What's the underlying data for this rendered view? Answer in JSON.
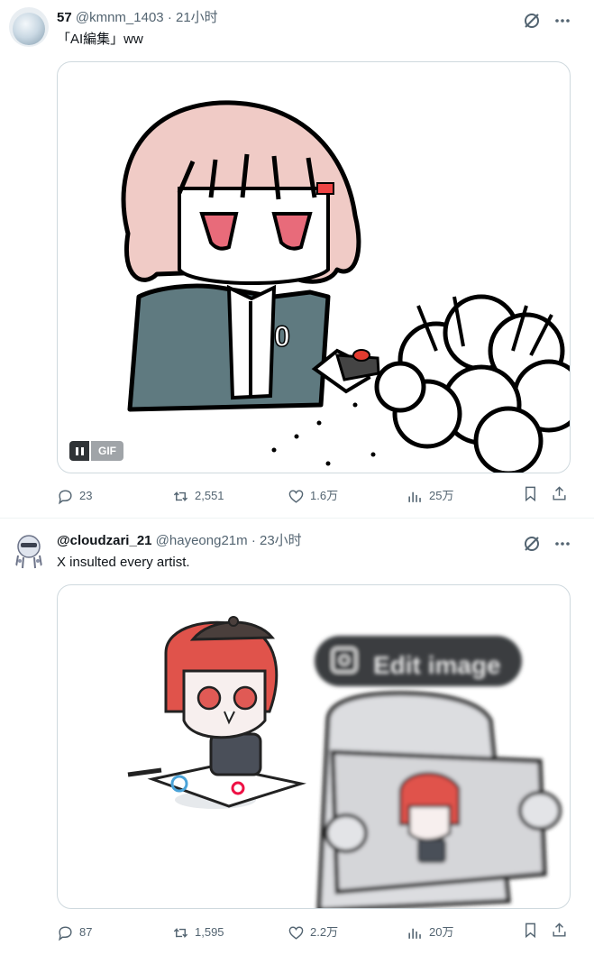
{
  "tweets": [
    {
      "display_name": "57",
      "handle": "@kmnm_1403",
      "separator": "·",
      "time": "21小时",
      "text": "「AI編集」ww",
      "media": {
        "type": "gif",
        "badge": "GIF"
      },
      "stats": {
        "replies": "23",
        "retweets": "2,551",
        "likes": "1.6万",
        "views": "25万"
      }
    },
    {
      "display_name": "@cloudzari_21",
      "handle": "@hayeong21m",
      "separator": "·",
      "time": "23小时",
      "text": "X insulted every artist.",
      "media": {
        "type": "image",
        "overlay_button": "Edit image"
      },
      "stats": {
        "replies": "87",
        "retweets": "1,595",
        "likes": "2.2万",
        "views": "20万"
      }
    }
  ],
  "icons": {
    "grok": "grok-icon",
    "more": "more-icon",
    "reply": "reply-icon",
    "retweet": "retweet-icon",
    "like": "like-icon",
    "views": "views-icon",
    "bookmark": "bookmark-icon",
    "share": "share-icon"
  },
  "colors": {
    "text": "#0f1419",
    "muted": "#536471",
    "border": "#cfd9de",
    "hair": "#f3a6a4",
    "hair2": "#e0534b",
    "jacket": "#5f7a80"
  }
}
